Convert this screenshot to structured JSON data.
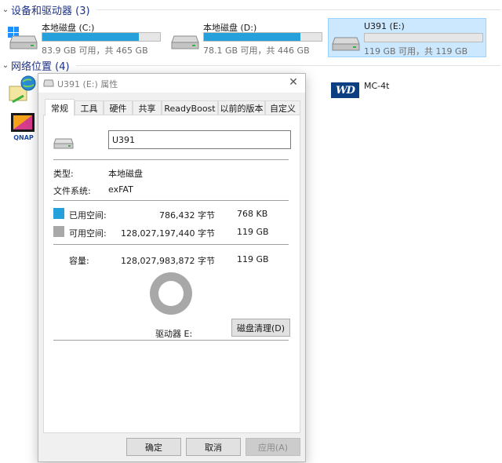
{
  "explorer": {
    "devices_header": "设备和驱动器 (3)",
    "network_header": "网络位置 (4)",
    "drives": [
      {
        "name": "本地磁盘 (C:)",
        "stat": "83.9 GB 可用，共 465 GB",
        "used_fraction": 0.82
      },
      {
        "name": "本地磁盘 (D:)",
        "stat": "78.1 GB 可用，共 446 GB",
        "used_fraction": 0.82
      },
      {
        "name": "U391 (E:)",
        "stat": "119 GB 可用，共 119 GB",
        "used_fraction": 0.0
      }
    ],
    "network": [
      {
        "name": "MC-4t",
        "icon": "wd-drive-icon",
        "logo_text": "WD"
      },
      {
        "name": "",
        "icon": "network-globe-icon"
      },
      {
        "name": "",
        "icon": "qnap-nas-icon",
        "logo_text": "QNAP"
      }
    ]
  },
  "dialog": {
    "title": "U391 (E:) 属性",
    "tabs": [
      "常规",
      "工具",
      "硬件",
      "共享",
      "ReadyBoost",
      "以前的版本",
      "自定义"
    ],
    "active_tab": "常规",
    "volume_name": "U391",
    "type_label": "类型:",
    "type_value": "本地磁盘",
    "fs_label": "文件系统:",
    "fs_value": "exFAT",
    "used_label": "已用空间:",
    "used_bytes": "786,432 字节",
    "used_size": "768 KB",
    "free_label": "可用空间:",
    "free_bytes": "128,027,197,440 字节",
    "free_size": "119 GB",
    "capacity_label": "容量:",
    "capacity_bytes": "128,027,983,872 字节",
    "capacity_size": "119 GB",
    "drive_label": "驱动器 E:",
    "cleanup_button": "磁盘清理(D)",
    "ok_button": "确定",
    "cancel_button": "取消",
    "apply_button": "应用(A)",
    "close_glyph": "✕",
    "used_color": "#26a0da",
    "free_color": "#a8a8a8"
  }
}
